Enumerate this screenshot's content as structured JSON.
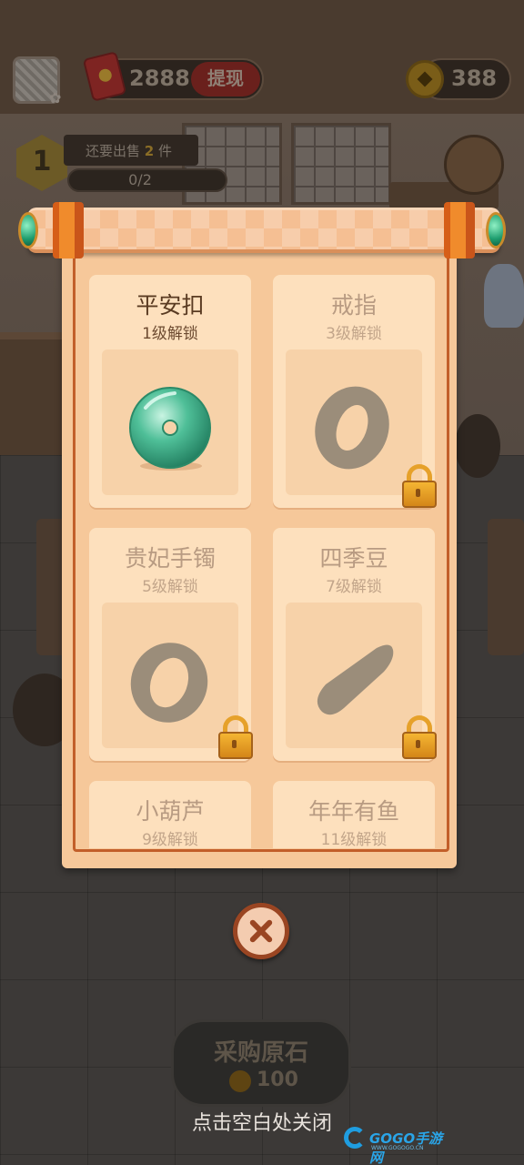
{
  "hud": {
    "money_value": "2888",
    "withdraw_label": "提现",
    "coin_value": "388"
  },
  "task": {
    "level": "1",
    "sell_prefix": "还要出售",
    "sell_count": "2",
    "sell_suffix": "件",
    "progress_text": "0/2",
    "progress_fraction": 0
  },
  "collection": {
    "items": [
      {
        "name": "平安扣",
        "unlock": "1级解锁",
        "locked": false,
        "icon": "jade-disc-icon"
      },
      {
        "name": "戒指",
        "unlock": "3级解锁",
        "locked": true,
        "icon": "ring-icon"
      },
      {
        "name": "贵妃手镯",
        "unlock": "5级解锁",
        "locked": true,
        "icon": "bangle-icon"
      },
      {
        "name": "四季豆",
        "unlock": "7级解锁",
        "locked": true,
        "icon": "bean-icon"
      },
      {
        "name": "小葫芦",
        "unlock": "9级解锁",
        "locked": true,
        "icon": "gourd-icon"
      },
      {
        "name": "年年有鱼",
        "unlock": "11级解锁",
        "locked": true,
        "icon": "fish-icon"
      }
    ]
  },
  "bottom": {
    "buy_label": "采购原石",
    "buy_price": "100",
    "close_hint": "点击空白处关闭"
  },
  "watermark": {
    "brand": "GOGO手游网",
    "url": "WWW.GOGOGO.CN"
  },
  "colors": {
    "paper": "#f6c89a",
    "card": "#fde0bd",
    "border": "#c25f2a",
    "jade": "#3fb08a",
    "silhouette": "#9b8d7a"
  }
}
